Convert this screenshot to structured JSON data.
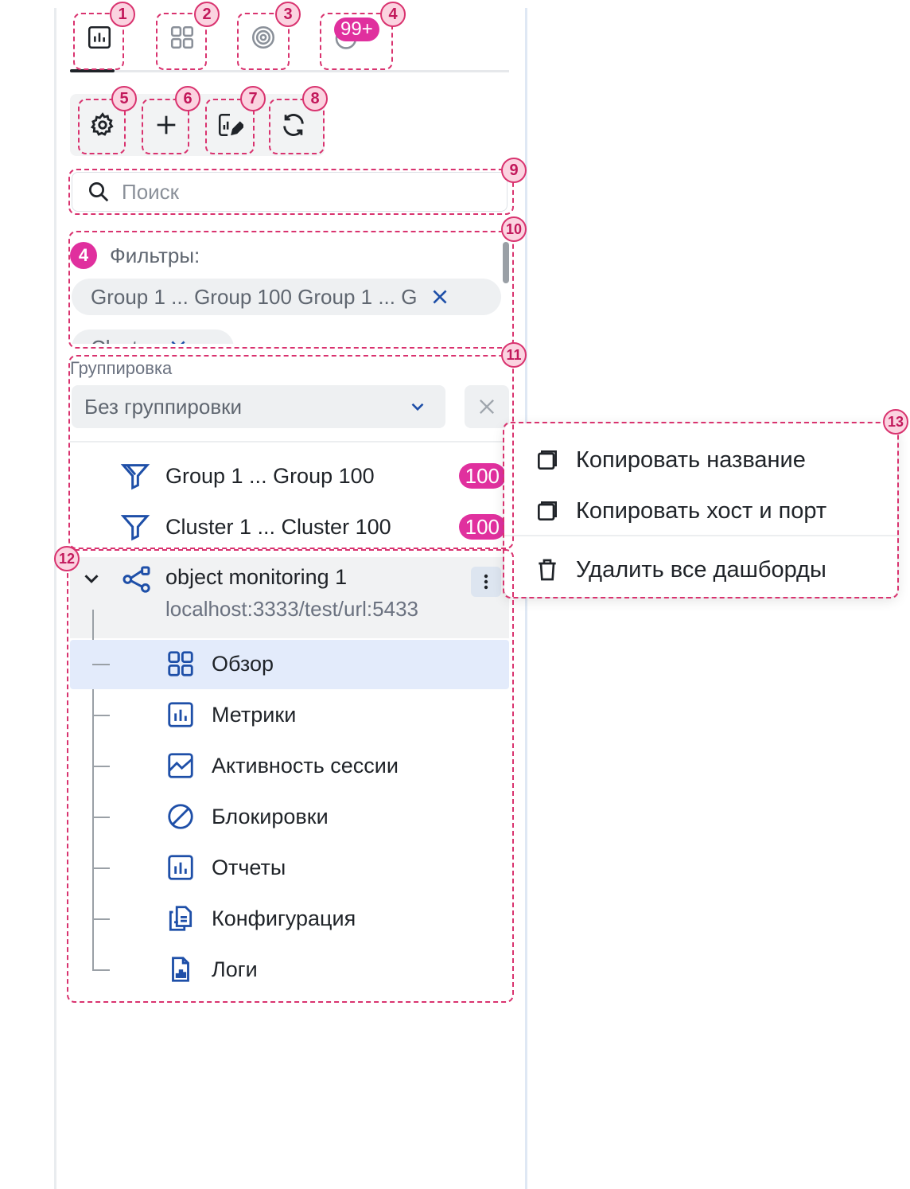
{
  "tabs": [
    {
      "icon": "chart-icon"
    },
    {
      "icon": "grid-icon"
    },
    {
      "icon": "target-icon"
    },
    {
      "icon": "gauge-icon",
      "badge": "99+"
    }
  ],
  "toolbar": [
    {
      "icon": "gear-icon"
    },
    {
      "icon": "plus-icon"
    },
    {
      "icon": "edit-chart-icon"
    },
    {
      "icon": "refresh-icon"
    }
  ],
  "search": {
    "placeholder": "Поиск"
  },
  "filters": {
    "count": "4",
    "label": "Фильтры:",
    "chips": [
      "Group 1 ... Group 100 Group 1 ... G",
      "Clust..."
    ]
  },
  "grouping": {
    "label": "Группировка",
    "selected": "Без группировки",
    "items": [
      {
        "label": "Group 1 ... Group 100",
        "count": "100"
      },
      {
        "label": "Cluster 1 ... Cluster 100",
        "count": "100"
      }
    ]
  },
  "tree": {
    "node": {
      "title": "object monitoring 1",
      "subtitle": "localhost:3333/test/url:5433"
    },
    "children": [
      {
        "label": "Обзор",
        "icon": "grid-icon",
        "selected": true
      },
      {
        "label": "Метрики",
        "icon": "chart-icon"
      },
      {
        "label": "Активность сессии",
        "icon": "image-chart-icon"
      },
      {
        "label": "Блокировки",
        "icon": "blocked-icon"
      },
      {
        "label": "Отчеты",
        "icon": "chart-icon"
      },
      {
        "label": "Конфигурация",
        "icon": "documents-icon"
      },
      {
        "label": "Логи",
        "icon": "log-file-icon"
      }
    ]
  },
  "context_menu": [
    {
      "label": "Копировать название",
      "icon": "copy-icon"
    },
    {
      "label": "Копировать хост и порт",
      "icon": "copy-icon"
    },
    {
      "label": "Удалить все дашборды",
      "icon": "trash-icon"
    }
  ],
  "annotations": [
    "1",
    "2",
    "3",
    "4",
    "5",
    "6",
    "7",
    "8",
    "9",
    "10",
    "11",
    "12",
    "13"
  ],
  "colors": {
    "accent": "#e0309e",
    "annotation": "#d9336f",
    "icon_blue": "#1e4fa8",
    "selected_bg": "#e3ebfb"
  }
}
